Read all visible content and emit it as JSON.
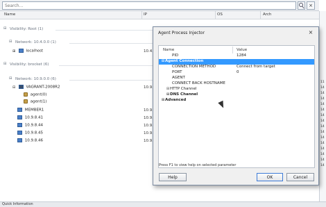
{
  "search": {
    "placeholder": "Search..."
  },
  "columns": [
    {
      "label": "Name"
    },
    {
      "label": "IP"
    },
    {
      "label": "OS"
    },
    {
      "label": "Arch"
    }
  ],
  "groups": [
    {
      "label": "Visibility: Root (1)",
      "networks": [
        {
          "label": "Network: 10.4.0.0 (1)",
          "hosts": [
            {
              "name": "localhost",
              "ip": "10.4."
            }
          ]
        }
      ]
    },
    {
      "label": "Visibility: brocket (6)",
      "networks": [
        {
          "label": "Network: 10.9.0.0 (6)",
          "hosts": [
            {
              "name": "VAGRANT-2008R2",
              "ip": "10.9.",
              "children": [
                "agent(0)",
                "agent(1)"
              ]
            },
            {
              "name": "MEMBER1",
              "ip": "10.9."
            },
            {
              "name": "10.9.8.41",
              "ip": "10.9."
            },
            {
              "name": "10.9.8.44",
              "ip": "10.9."
            },
            {
              "name": "10.9.8.45",
              "ip": "10.9."
            },
            {
              "name": "10.9.8.46",
              "ip": "10.9."
            }
          ]
        }
      ]
    }
  ],
  "side_numbers": [
    "11",
    "14",
    "14",
    "14",
    "14",
    "14",
    "14",
    "14",
    "14",
    "14",
    "14",
    "14",
    "14",
    "14",
    "14",
    "14"
  ],
  "quick_info": "Quick Information",
  "dialog": {
    "title": "Agent Process Injector",
    "headers": {
      "name": "Name",
      "value": "Value"
    },
    "rows": [
      {
        "key": "PID",
        "value": "1284",
        "indent": 2
      },
      {
        "key": "Agent Connection",
        "value": "",
        "indent": 0,
        "expand": "⊟",
        "bold": true,
        "selected": true
      },
      {
        "key": "CONNECTION METHOD",
        "value": "Connect from target",
        "indent": 2
      },
      {
        "key": "PORT",
        "value": "0",
        "indent": 2
      },
      {
        "key": "AGENT",
        "value": "",
        "indent": 2
      },
      {
        "key": "CONNECT BACK HOSTNAME",
        "value": "",
        "indent": 2
      },
      {
        "key": "HTTP Channel",
        "value": "",
        "indent": 1,
        "expand": "⊞"
      },
      {
        "key": "DNS Channel",
        "value": "",
        "indent": 1,
        "expand": "⊞",
        "bold": true
      },
      {
        "key": "Advanced",
        "value": "",
        "indent": 0,
        "expand": "⊞",
        "bold": true
      }
    ],
    "hint": "Press F1 to view help on selected parameter",
    "buttons": {
      "help": "Help",
      "ok": "OK",
      "cancel": "Cancel"
    }
  },
  "colors": {
    "selection": "#3399ff",
    "accent": "#3d7bd8",
    "host_icon": "#4a7fc8"
  }
}
